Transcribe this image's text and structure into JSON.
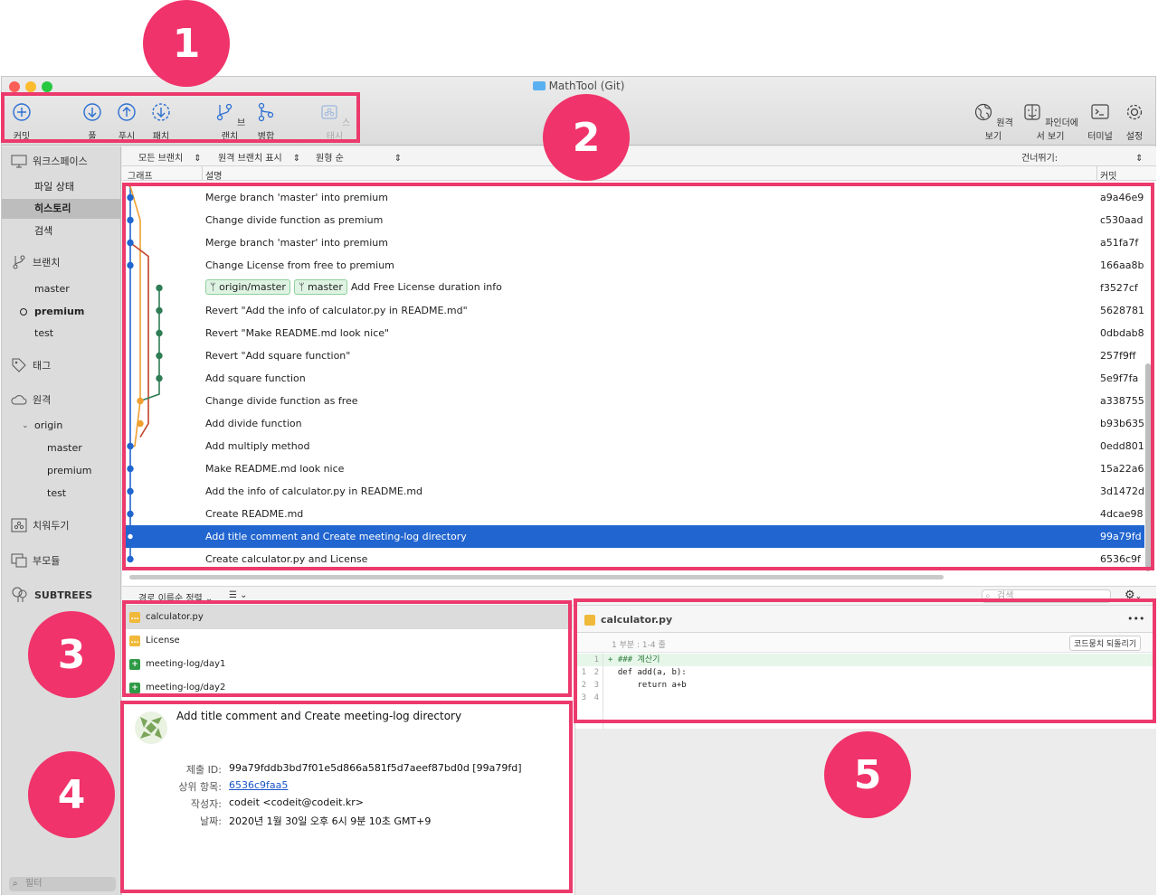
{
  "badges": {
    "b1": "1",
    "b2": "2",
    "b3": "3",
    "b4": "4",
    "b5": "5"
  },
  "window": {
    "title": "MathTool (Git)"
  },
  "toolbar": {
    "commit": "커밋",
    "pull": "풀",
    "push": "푸시",
    "fetch": "패치",
    "branch": "브랜치",
    "merge": "병합",
    "stash": "스태시",
    "remote_view": "원격 보기",
    "finder_view": "파인더에서 보기",
    "terminal": "터미널",
    "settings": "설정"
  },
  "sidebar": {
    "workspace": "워크스페이스",
    "file_status": "파일 상태",
    "history": "히스토리",
    "search": "검색",
    "branches": "브랜치",
    "branch_items": [
      "master",
      "premium",
      "test"
    ],
    "tags": "태그",
    "remotes": "원격",
    "origin": "origin",
    "origin_items": [
      "master",
      "premium",
      "test"
    ],
    "stash": "치워두기",
    "submodules": "부모듈",
    "subtrees": "SUBTREES",
    "filter_placeholder": "필터"
  },
  "filterbar": {
    "all_branches": "모든 브랜치",
    "show_remote": "원격 브랜치 표시",
    "order": "원형 순",
    "jump": "건너뛰기:"
  },
  "columns": {
    "graph": "그래프",
    "description": "설명",
    "commit": "커밋"
  },
  "commits": [
    {
      "msg": "Merge branch 'master' into premium",
      "sha": "a9a46e9"
    },
    {
      "msg": "Change divide function as premium",
      "sha": "c530aad"
    },
    {
      "msg": "Merge branch 'master' into premium",
      "sha": "a51fa7f"
    },
    {
      "msg": "Change License from free to premium",
      "sha": "166aa8b"
    },
    {
      "msg": "Add Free License duration info",
      "sha": "f3527cf",
      "tags": [
        "origin/master",
        "master"
      ]
    },
    {
      "msg": "Revert \"Add the info of calculator.py in README.md\"",
      "sha": "5628781"
    },
    {
      "msg": "Revert \"Make README.md look nice\"",
      "sha": "0dbdab8"
    },
    {
      "msg": "Revert \"Add square function\"",
      "sha": "257f9ff"
    },
    {
      "msg": "Add square function",
      "sha": "5e9f7fa"
    },
    {
      "msg": "Change divide function as free",
      "sha": "a338755"
    },
    {
      "msg": "Add divide function",
      "sha": "b93b635"
    },
    {
      "msg": "Add multiply method",
      "sha": "0edd801"
    },
    {
      "msg": "Make README.md look nice",
      "sha": "15a22a6"
    },
    {
      "msg": "Add the info of calculator.py in README.md",
      "sha": "3d1472d"
    },
    {
      "msg": "Create README.md",
      "sha": "4dcae98"
    },
    {
      "msg": "Add title comment and Create meeting-log directory",
      "sha": "99a79fd",
      "selected": true
    },
    {
      "msg": "Create calculator.py and License",
      "sha": "6536c9f"
    }
  ],
  "lower": {
    "sort": "경로 이름순 정렬",
    "search_placeholder": "검색"
  },
  "files": [
    {
      "name": "calculator.py",
      "kind": "modified",
      "selected": true
    },
    {
      "name": "License",
      "kind": "modified"
    },
    {
      "name": "meeting-log/day1",
      "kind": "added"
    },
    {
      "name": "meeting-log/day2",
      "kind": "added"
    }
  ],
  "details": {
    "subject": "Add title comment and Create meeting-log directory",
    "id_label": "제출 ID:",
    "id_value": "99a79fddb3bd7f01e5d866a581f5d7aeef87bd0d [99a79fd]",
    "parent_label": "상위 항목:",
    "parent_value": "6536c9faa5",
    "author_label": "작성자:",
    "author_value": "codeit <codeit@codeit.kr>",
    "date_label": "날짜:",
    "date_value": "2020년 1월 30일 오후 6시 9분 10초 GMT+9"
  },
  "diff": {
    "filename": "calculator.py",
    "more": "•••",
    "hunk": "1 부분 : 1-4 줄",
    "revert": "코드뭉치 되돌리기",
    "lines": [
      {
        "old": "",
        "new": "1",
        "text": "+ ### 계산기",
        "added": true
      },
      {
        "old": "1",
        "new": "2",
        "text": "  def add(a, b):"
      },
      {
        "old": "2",
        "new": "3",
        "text": "      return a+b"
      },
      {
        "old": "3",
        "new": "4",
        "text": ""
      }
    ]
  },
  "colors": {
    "accent": "#2165d0",
    "highlight": "#ec3a6d",
    "badge": "#f0336a"
  }
}
